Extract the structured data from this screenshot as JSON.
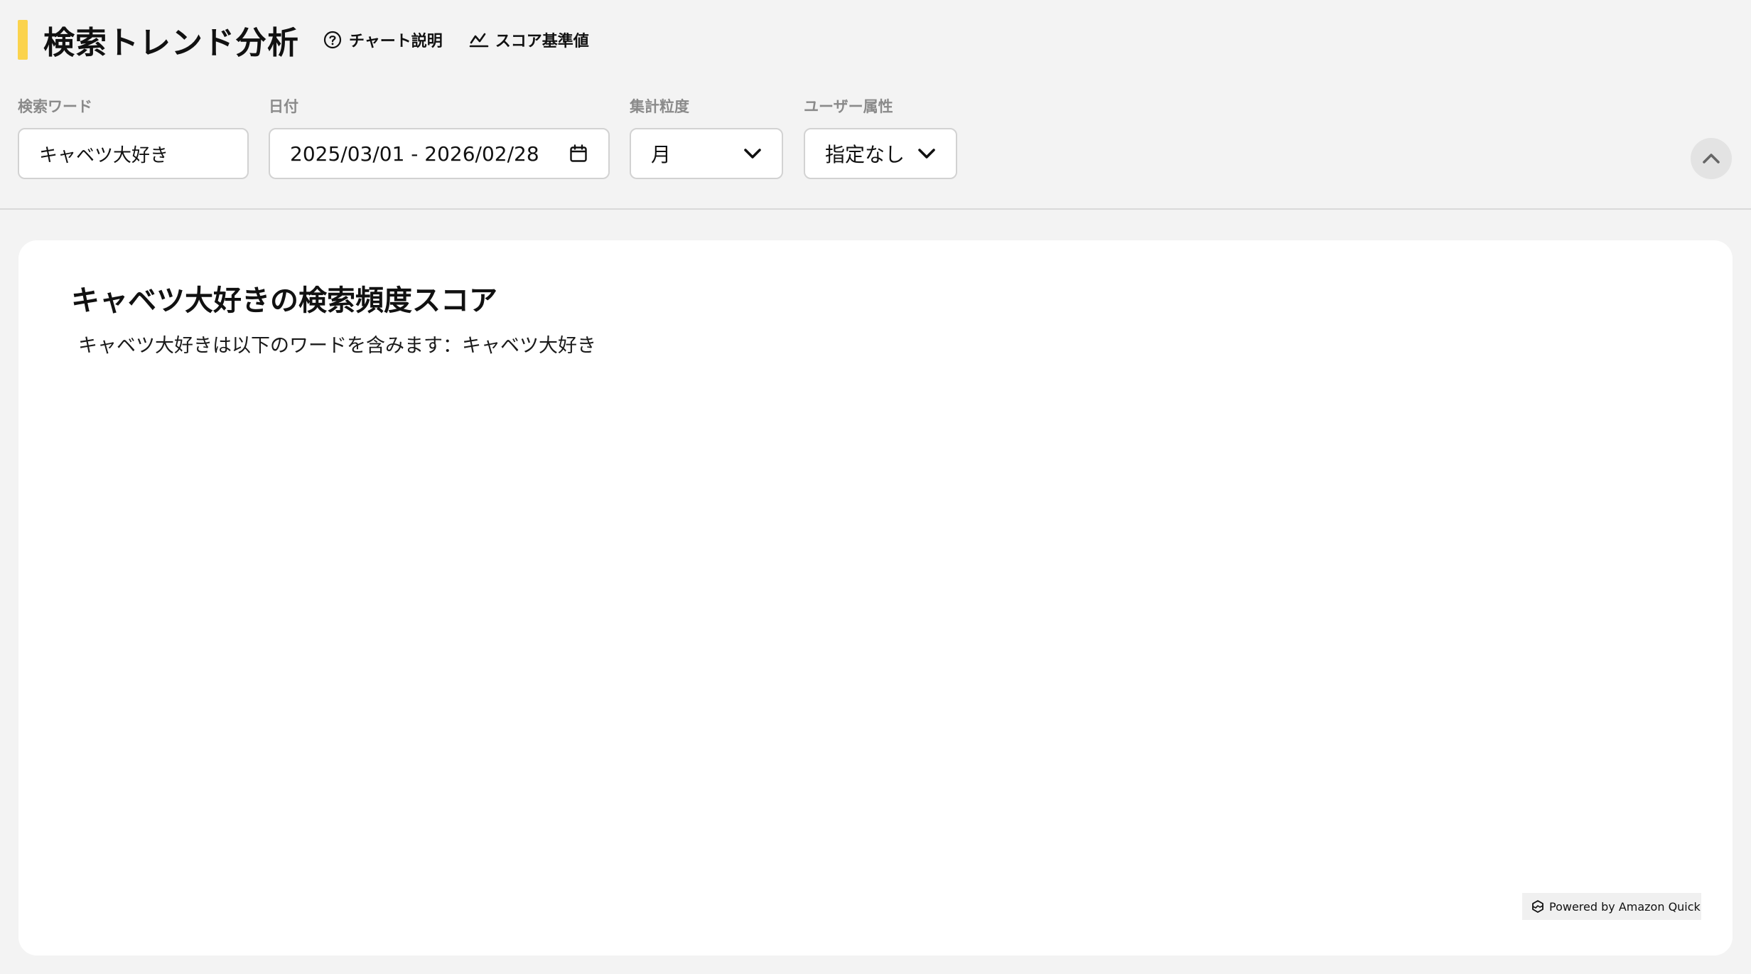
{
  "header": {
    "title": "検索トレンド分析",
    "links": {
      "chart_help": "チャート説明",
      "score_baseline": "スコア基準値"
    },
    "accent_color": "#fbd34d"
  },
  "filters": {
    "keyword": {
      "label": "検索ワード",
      "value": "キャベツ大好き"
    },
    "date": {
      "label": "日付",
      "value": "2025/03/01 - 2026/02/28"
    },
    "granularity": {
      "label": "集計粒度",
      "value": "月"
    },
    "user_attr": {
      "label": "ユーザー属性",
      "value": "指定なし"
    }
  },
  "card": {
    "title": "キャベツ大好きの検索頻度スコア",
    "description": "キャベツ大好きは以下のワードを含みます：キャベツ大好き"
  },
  "footer": {
    "powered_by": "Powered by Amazon Quick"
  }
}
